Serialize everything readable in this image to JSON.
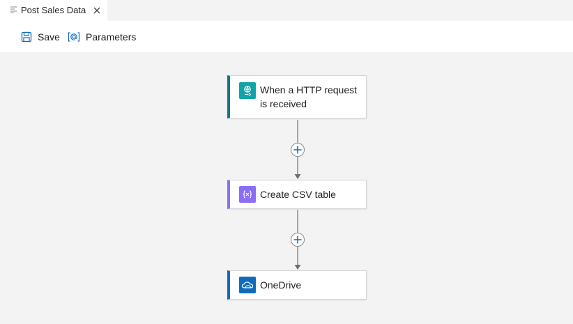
{
  "tab": {
    "title": "Post Sales Data"
  },
  "toolbar": {
    "save_label": "Save",
    "parameters_label": "Parameters"
  },
  "nodes": [
    {
      "label": "When a HTTP request is received",
      "icon": "http-request-icon"
    },
    {
      "label": "Create CSV table",
      "icon": "csv-table-icon"
    },
    {
      "label": "OneDrive",
      "icon": "onedrive-icon"
    }
  ],
  "colors": {
    "trigger_accent": "#0f7a84",
    "trigger_icon_bg": "#10a3a8",
    "csv_accent": "#8b6ef5",
    "onedrive_accent": "#0f6cbd",
    "add_plus": "#0f6cbd"
  }
}
